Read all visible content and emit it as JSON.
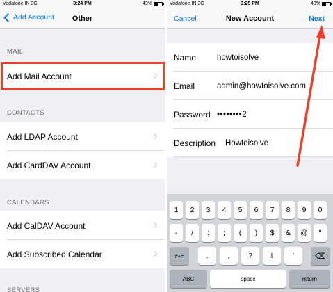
{
  "left": {
    "status": {
      "carrier": "Vodafone IN  3G",
      "time": "3:24 PM",
      "battery": "43%",
      "battery_level": 0.43
    },
    "nav": {
      "back_label": "Add Account",
      "title": "Other"
    },
    "sections": [
      {
        "header": "MAIL",
        "items": [
          "Add Mail Account"
        ]
      },
      {
        "header": "CONTACTS",
        "items": [
          "Add LDAP Account",
          "Add CardDAV Account"
        ]
      },
      {
        "header": "CALENDARS",
        "items": [
          "Add CalDAV Account",
          "Add Subscribed Calendar"
        ]
      },
      {
        "header": "SERVERS",
        "items": []
      }
    ]
  },
  "right": {
    "status": {
      "carrier": "Vodafone IN  3G",
      "time": "3:25 PM",
      "battery": "43%",
      "battery_level": 0.43
    },
    "nav": {
      "cancel_label": "Cancel",
      "title": "New Account",
      "next_label": "Next"
    },
    "form": [
      {
        "label": "Name",
        "value": "howtoisolve"
      },
      {
        "label": "Email",
        "value": "admin@howtoisolve.com"
      },
      {
        "label": "Password",
        "value": "••••••••2"
      },
      {
        "label": "Description",
        "value": "Howtoisolve"
      }
    ],
    "keyboard": {
      "row1": [
        "1",
        "2",
        "3",
        "4",
        "5",
        "6",
        "7",
        "8",
        "9",
        "0"
      ],
      "row2": [
        "-",
        "/",
        ":",
        ";",
        "(",
        ")",
        "$",
        "&",
        "@",
        "\""
      ],
      "row3_left": "#+=",
      "row3": [
        ".",
        ",",
        "?",
        "!",
        "'"
      ],
      "row3_right": "⌫",
      "bottom": {
        "abc": "ABC",
        "space": "space",
        "return": "return"
      }
    }
  },
  "colors": {
    "accent": "#007aff",
    "highlight": "#e8412c"
  },
  "icons": [
    "back-chevron-icon",
    "battery-icon",
    "disclosure-chevron-icon",
    "backspace-icon",
    "red-arrow-annotation"
  ]
}
